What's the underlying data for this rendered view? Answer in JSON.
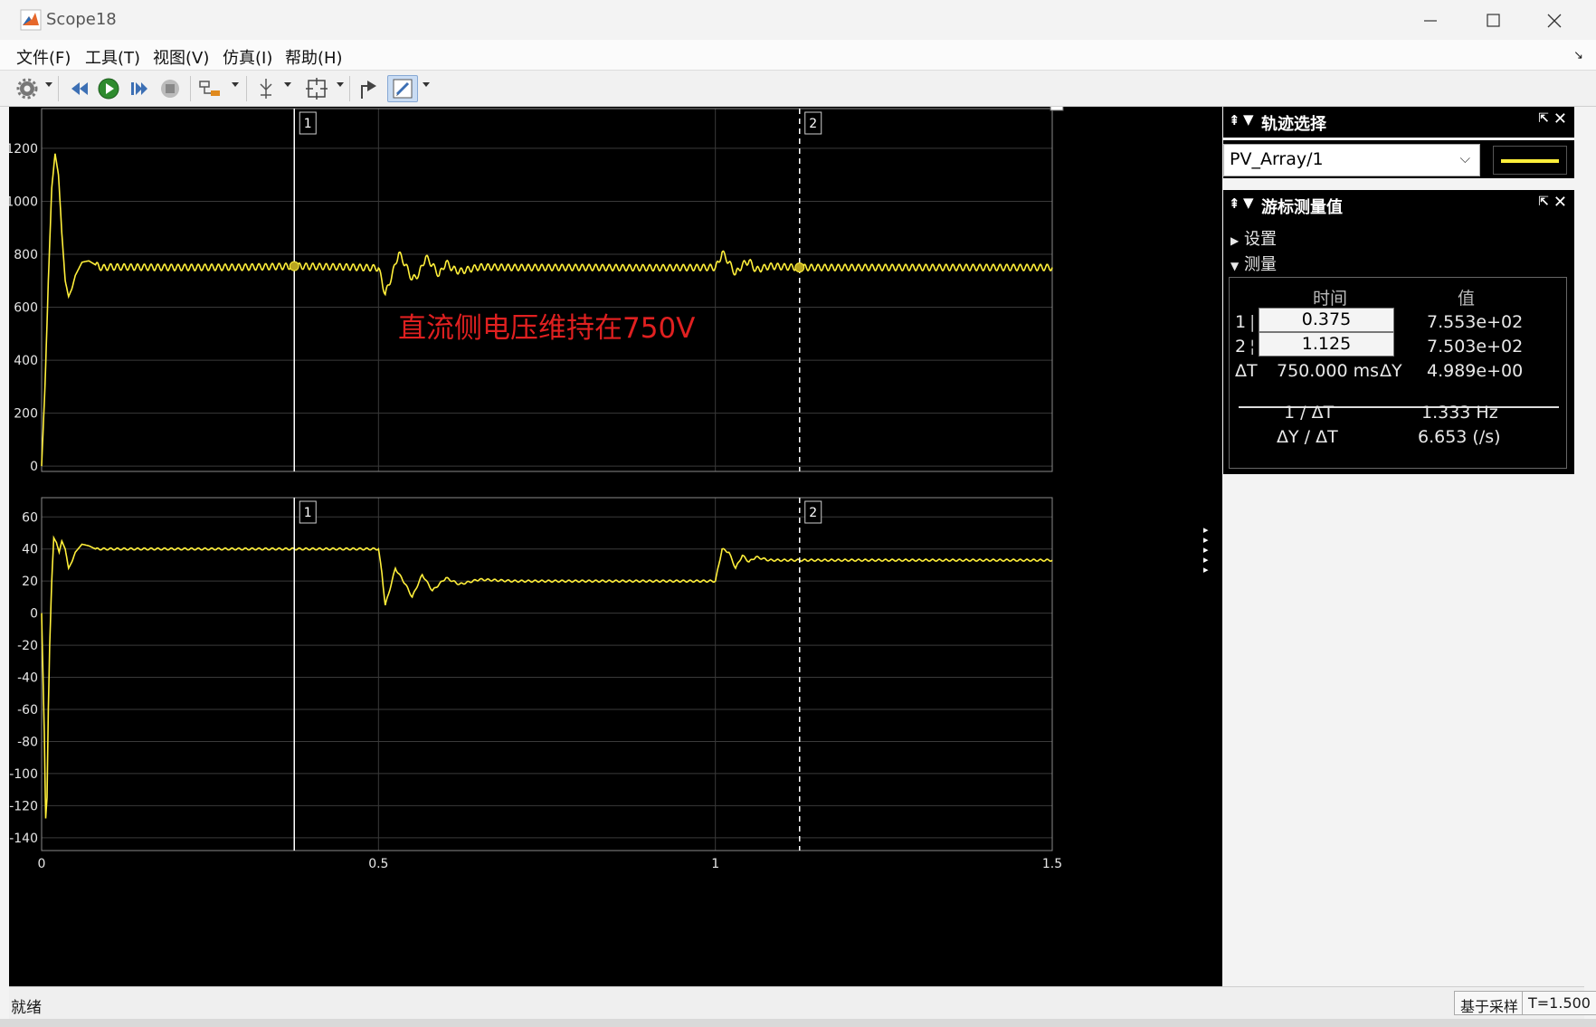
{
  "window": {
    "title": "Scope18",
    "app_icon": "matlab-icon",
    "controls": {
      "minimize": "minimize-icon",
      "maximize": "maximize-icon",
      "close": "close-icon"
    }
  },
  "menu": [
    "文件(F)",
    "工具(T)",
    "视图(V)",
    "仿真(I)",
    "帮助(H)"
  ],
  "toolbar": {
    "buttons": [
      "settings-icon",
      "step-back-icon",
      "run-icon",
      "step-forward-icon",
      "stop-icon",
      "highlight-signal-icon",
      "trigger-icon",
      "zoom-fit-icon",
      "write-to-workspace-icon",
      "edit-cursor-icon"
    ]
  },
  "colors": {
    "trace": "#ffef3a",
    "plot_bg": "#000000",
    "grid": "#3a3a3a",
    "annotation": "#e02020"
  },
  "chart_data": [
    {
      "type": "line",
      "title": "",
      "xlim": [
        0,
        1.5
      ],
      "ylim": [
        -20,
        1350
      ],
      "yticks": [
        "1200",
        "1000",
        "800",
        "600",
        "400",
        "200",
        "0"
      ],
      "yticks_values": [
        1200,
        1000,
        800,
        600,
        400,
        200,
        0
      ],
      "annotation": "直流侧电压维持在750V",
      "series": [
        {
          "points": [
            [
              0,
              0
            ],
            [
              0.005,
              300
            ],
            [
              0.01,
              700
            ],
            [
              0.015,
              1050
            ],
            [
              0.02,
              1180
            ],
            [
              0.025,
              1100
            ],
            [
              0.03,
              880
            ],
            [
              0.035,
              700
            ],
            [
              0.04,
              640
            ],
            [
              0.045,
              670
            ],
            [
              0.05,
              720
            ],
            [
              0.06,
              770
            ],
            [
              0.07,
              775
            ],
            [
              0.08,
              760
            ],
            [
              0.09,
              748
            ],
            [
              0.1,
              752
            ],
            [
              0.2,
              750
            ],
            [
              0.3,
              751
            ],
            [
              0.375,
              755
            ],
            [
              0.45,
              752
            ],
            [
              0.5,
              748
            ],
            [
              0.505,
              700
            ],
            [
              0.51,
              648
            ],
            [
              0.52,
              720
            ],
            [
              0.53,
              805
            ],
            [
              0.54,
              760
            ],
            [
              0.55,
              705
            ],
            [
              0.56,
              725
            ],
            [
              0.57,
              790
            ],
            [
              0.58,
              760
            ],
            [
              0.59,
              720
            ],
            [
              0.6,
              770
            ],
            [
              0.61,
              745
            ],
            [
              0.62,
              735
            ],
            [
              0.65,
              752
            ],
            [
              0.7,
              750
            ],
            [
              0.8,
              750
            ],
            [
              0.9,
              749
            ],
            [
              1.0,
              750
            ],
            [
              1.005,
              770
            ],
            [
              1.01,
              808
            ],
            [
              1.02,
              770
            ],
            [
              1.03,
              725
            ],
            [
              1.04,
              760
            ],
            [
              1.05,
              775
            ],
            [
              1.06,
              740
            ],
            [
              1.08,
              755
            ],
            [
              1.125,
              750
            ],
            [
              1.2,
              750
            ],
            [
              1.3,
              750
            ],
            [
              1.4,
              750
            ],
            [
              1.5,
              750
            ]
          ],
          "ripple": 12
        }
      ]
    },
    {
      "type": "line",
      "title": "",
      "xlim": [
        0,
        1.5
      ],
      "ylim": [
        -148,
        72
      ],
      "xticks": [
        "0",
        "0.5",
        "1",
        "1.5"
      ],
      "xticks_values": [
        0,
        0.5,
        1,
        1.5
      ],
      "yticks": [
        "60",
        "40",
        "20",
        "0",
        "-20",
        "-40",
        "-60",
        "-80",
        "-100",
        "-120",
        "-140"
      ],
      "yticks_values": [
        60,
        40,
        20,
        0,
        -20,
        -40,
        -60,
        -80,
        -100,
        -120,
        -140
      ],
      "series": [
        {
          "points": [
            [
              0,
              0
            ],
            [
              0.004,
              -75
            ],
            [
              0.006,
              -128
            ],
            [
              0.008,
              -115
            ],
            [
              0.01,
              -60
            ],
            [
              0.012,
              -20
            ],
            [
              0.015,
              20
            ],
            [
              0.018,
              47
            ],
            [
              0.022,
              44
            ],
            [
              0.026,
              38
            ],
            [
              0.03,
              45
            ],
            [
              0.035,
              40
            ],
            [
              0.04,
              28
            ],
            [
              0.045,
              32
            ],
            [
              0.05,
              38
            ],
            [
              0.06,
              43
            ],
            [
              0.07,
              42
            ],
            [
              0.08,
              40
            ],
            [
              0.1,
              40
            ],
            [
              0.2,
              40
            ],
            [
              0.3,
              40
            ],
            [
              0.4,
              40
            ],
            [
              0.5,
              40
            ],
            [
              0.505,
              25
            ],
            [
              0.51,
              5
            ],
            [
              0.515,
              12
            ],
            [
              0.525,
              28
            ],
            [
              0.54,
              18
            ],
            [
              0.55,
              10
            ],
            [
              0.565,
              24
            ],
            [
              0.58,
              14
            ],
            [
              0.6,
              22
            ],
            [
              0.62,
              18
            ],
            [
              0.65,
              21
            ],
            [
              0.7,
              20
            ],
            [
              0.8,
              20
            ],
            [
              0.9,
              20
            ],
            [
              1.0,
              20
            ],
            [
              1.005,
              30
            ],
            [
              1.01,
              40
            ],
            [
              1.02,
              38
            ],
            [
              1.03,
              28
            ],
            [
              1.04,
              36
            ],
            [
              1.05,
              32
            ],
            [
              1.06,
              35
            ],
            [
              1.08,
              33
            ],
            [
              1.125,
              33
            ],
            [
              1.2,
              33
            ],
            [
              1.3,
              33
            ],
            [
              1.4,
              33
            ],
            [
              1.5,
              33
            ]
          ],
          "ripple": 0.6
        }
      ]
    }
  ],
  "cursors": [
    {
      "label": "1",
      "x": 0.375,
      "style": "solid",
      "marker_y": 755
    },
    {
      "label": "2",
      "x": 1.125,
      "style": "dashed",
      "marker_y": 750
    }
  ],
  "trace_panel": {
    "title": "轨迹选择",
    "selected": "PV_Array/1"
  },
  "cursor_panel": {
    "title": "游标测量值",
    "settings_label": "设置",
    "measure_label": "测量",
    "col_time": "时间",
    "col_value": "值",
    "rows": [
      {
        "id": "1",
        "time": "0.375",
        "value": "7.553e+02"
      },
      {
        "id": "2",
        "time": "1.125",
        "value": "7.503e+02"
      }
    ],
    "dt_label": "ΔT",
    "dt_value": "750.000 ms",
    "dy_label": "ΔY",
    "dy_value": "4.989e+00",
    "inv_dt_label": "1 / ΔT",
    "inv_dt_value": "1.333 Hz",
    "slope_label": "ΔY / ΔT",
    "slope_value": "6.653 (/s)"
  },
  "status": {
    "text": "就绪",
    "mode": "基于采样",
    "time": "T=1.500"
  }
}
